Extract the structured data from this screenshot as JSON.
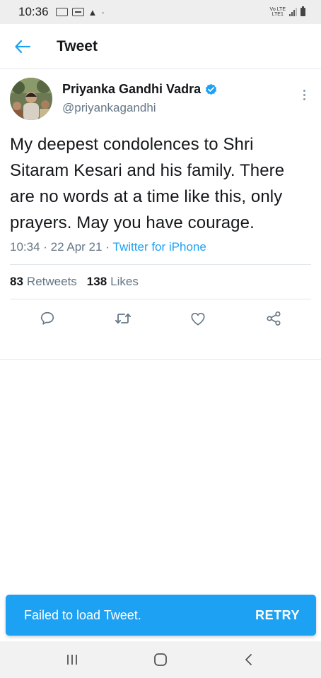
{
  "status_bar": {
    "time": "10:36",
    "network_line1": "Vo LTE",
    "network_line2": "LTE1"
  },
  "header": {
    "title": "Tweet",
    "back_icon": "arrow-left-icon"
  },
  "tweet": {
    "author_name": "Priyanka Gandhi Vadra",
    "author_handle": "@priyankagandhi",
    "verified": true,
    "text": "My deepest condolences to Shri Sitaram Kesari and his family. There are no words at a time like this, only prayers. May you have courage.",
    "time": "10:34",
    "date": "22 Apr 21",
    "source": "Twitter for iPhone",
    "separator": " · ",
    "retweets_count": "83",
    "retweets_label": "Retweets",
    "likes_count": "138",
    "likes_label": "Likes"
  },
  "actions": [
    "reply-icon",
    "retweet-icon",
    "like-icon",
    "share-icon"
  ],
  "snackbar": {
    "message": "Failed to load Tweet.",
    "action": "RETRY"
  },
  "colors": {
    "accent": "#1da1f2",
    "text_primary": "#14171a",
    "text_secondary": "#657786"
  }
}
